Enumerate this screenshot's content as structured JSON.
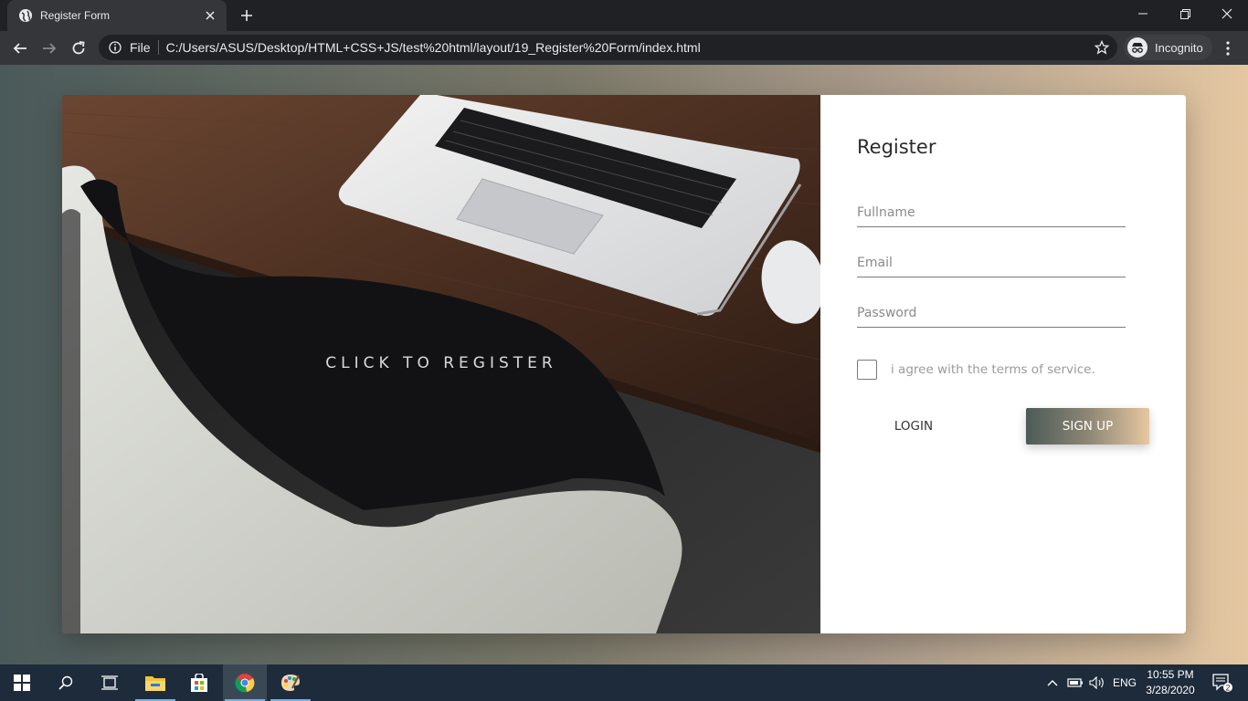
{
  "browser": {
    "tab_title": "Register Form",
    "file_label": "File",
    "url": "C:/Users/ASUS/Desktop/HTML+CSS+JS/test%20html/layout/19_Register%20Form/index.html",
    "profile_label": "Incognito"
  },
  "hero": {
    "cta": "CLICK TO REGISTER"
  },
  "form": {
    "title": "Register",
    "fullname_placeholder": "Fullname",
    "email_placeholder": "Email",
    "password_placeholder": "Password",
    "terms_label": "i agree with the terms of service.",
    "login_label": "LOGIN",
    "signup_label": "SIGN UP"
  },
  "taskbar": {
    "language": "ENG",
    "time": "10:55 PM",
    "date": "3/28/2020",
    "notification_count": "2"
  },
  "colors": {
    "page_gradient_start": "#4a5a5a",
    "page_gradient_end": "#e4c7a1",
    "button_gradient_start": "#4c5a58",
    "button_gradient_end": "#e6c7a0"
  }
}
